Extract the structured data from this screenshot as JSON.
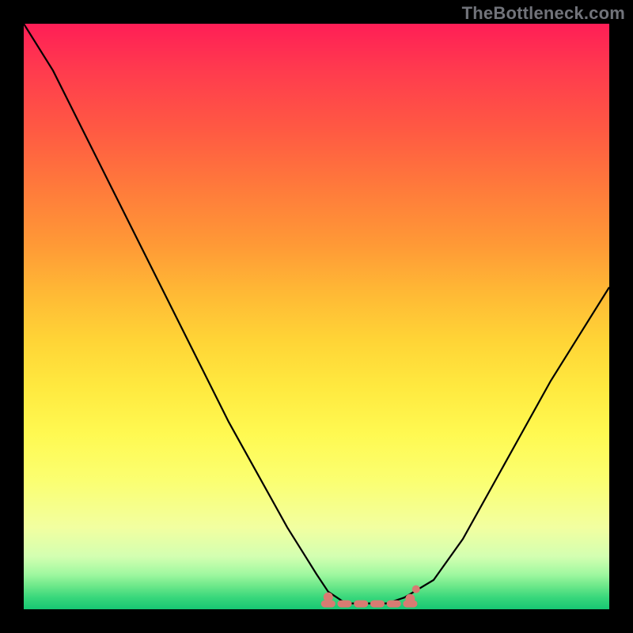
{
  "watermark": "TheBottleneck.com",
  "chart_data": {
    "type": "line",
    "title": "",
    "xlabel": "",
    "ylabel": "",
    "xlim": [
      0,
      100
    ],
    "ylim": [
      0,
      100
    ],
    "x": [
      0,
      5,
      10,
      15,
      20,
      25,
      30,
      35,
      40,
      45,
      50,
      52,
      55,
      58,
      60,
      62,
      65,
      70,
      75,
      80,
      85,
      90,
      95,
      100
    ],
    "values": [
      100,
      92,
      82,
      72,
      62,
      52,
      42,
      32,
      23,
      14,
      6,
      3,
      1,
      1,
      1,
      1,
      2,
      5,
      12,
      21,
      30,
      39,
      47,
      55
    ],
    "flat_region": {
      "x_start": 52,
      "x_end": 66,
      "y": 1
    },
    "marker_color": "#d87b72",
    "curve_color": "#000000"
  }
}
